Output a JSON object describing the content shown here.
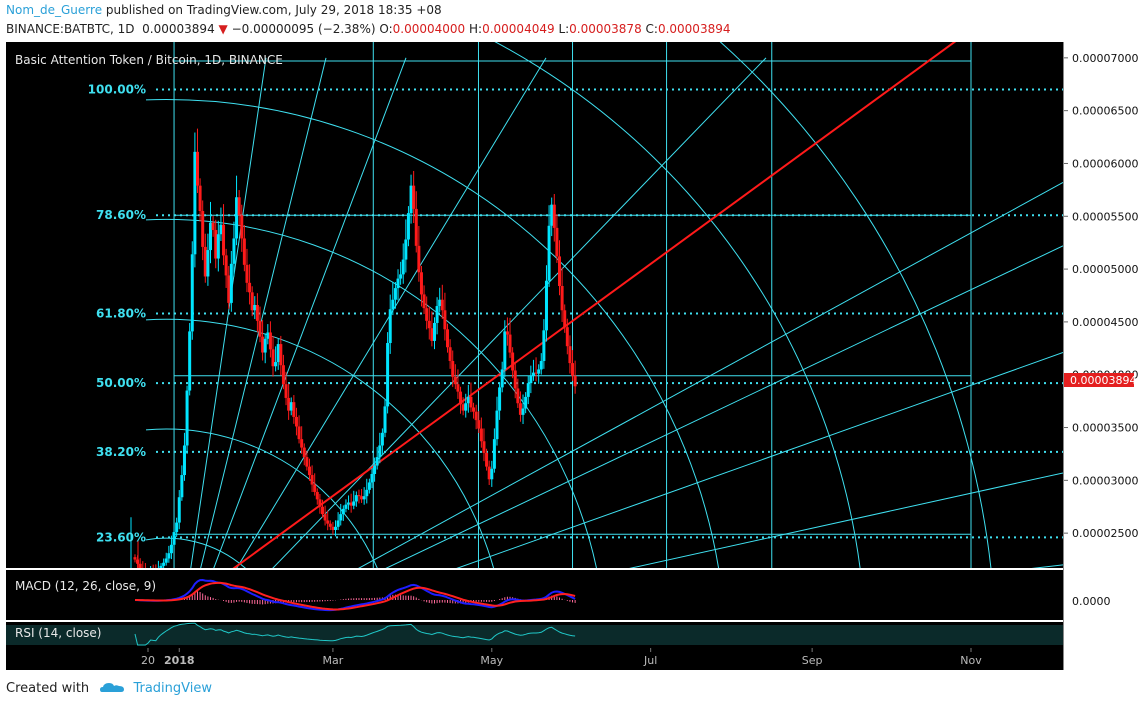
{
  "header": {
    "author": "Nom_de_Guerre",
    "published": "published on TradingView.com, July 29, 2018 18:35 +08",
    "symbol": "BINANCE:BATBTC, 1D",
    "last": "0.00003894",
    "change_arrow": "▼",
    "change": "−0.00000095 (−2.38%)",
    "o_label": "O:",
    "o_value": "0.00004000",
    "h_label": "H:",
    "h_value": "0.00004049",
    "l_label": "L:",
    "l_value": "0.00003878",
    "c_label": "C:",
    "c_value": "0.00003894"
  },
  "footer": {
    "created_with": "Created with",
    "brand": "TradingView",
    "logo_icon": "tradingview-cloud-icon"
  },
  "colors": {
    "bg": "#000000",
    "up": "#00e5ff",
    "down": "#ff1a1a",
    "fib": "#3fe0f0",
    "macd": "#1e1eff",
    "signal": "#ff2020",
    "rsi": "#20c8c8",
    "price_badge": "#e41f1f"
  },
  "chart_data": {
    "type": "candlestick",
    "title": "Basic Attention Token / Bitcoin, 1D, BINANCE",
    "y_ticks": [
      "0.00007000",
      "0.00006500",
      "0.00006000",
      "0.00005500",
      "0.00005000",
      "0.00004500",
      "0.00004000",
      "0.00003500",
      "0.00003000",
      "0.00002500"
    ],
    "ylim": [
      2.17e-05,
      7.15e-05
    ],
    "x_ticks": [
      "20",
      "2018",
      "Mar",
      "May",
      "Jul",
      "Sep",
      "Nov"
    ],
    "x_tick_dates": [
      "2017-12-20",
      "2018-01-01",
      "2018-03-01",
      "2018-05-01",
      "2018-07-01",
      "2018-09-01",
      "2018-11-01"
    ],
    "last_price": "0.00003894",
    "fib_levels": [
      {
        "label": "100.00%",
        "value": 6.7e-05
      },
      {
        "label": "78.60%",
        "value": 5.51e-05
      },
      {
        "label": "61.80%",
        "value": 4.58e-05
      },
      {
        "label": "50.00%",
        "value": 3.92e-05
      },
      {
        "label": "38.20%",
        "value": 3.27e-05
      },
      {
        "label": "23.60%",
        "value": 2.46e-05
      }
    ],
    "gann_lines": [
      6.97e-05,
      5.51e-05,
      3.99e-05,
      2.49e-05
    ],
    "close_series": {
      "start": "2017-12-15",
      "values": [
        2.25e-05,
        2.21e-05,
        2.17e-05,
        2.14e-05,
        2.12e-05,
        2.13e-05,
        2.15e-05,
        2.14e-05,
        2.13e-05,
        2.16e-05,
        2.19e-05,
        2.22e-05,
        2.26e-05,
        2.31e-05,
        2.39e-05,
        2.51e-05,
        2.6e-05,
        2.84e-05,
        3.05e-05,
        3.33e-05,
        3.85e-05,
        4.41e-05,
        5.14e-05,
        6.11e-05,
        5.79e-05,
        5.55e-05,
        5.21e-05,
        4.93e-05,
        5.18e-05,
        5.44e-05,
        5.37e-05,
        5.1e-05,
        5.33e-05,
        5.42e-05,
        5.13e-05,
        4.94e-05,
        4.68e-05,
        5.05e-05,
        5.29e-05,
        5.68e-05,
        5.51e-05,
        5.29e-05,
        5.04e-05,
        4.87e-05,
        4.78e-05,
        4.61e-05,
        4.66e-05,
        4.51e-05,
        4.36e-05,
        4.21e-05,
        4.34e-05,
        4.4e-05,
        4.24e-05,
        4.08e-05,
        4.12e-05,
        4.29e-05,
        4.09e-05,
        3.91e-05,
        3.78e-05,
        3.66e-05,
        3.74e-05,
        3.6e-05,
        3.51e-05,
        3.39e-05,
        3.31e-05,
        3.22e-05,
        3.13e-05,
        3.05e-05,
        2.96e-05,
        2.89e-05,
        2.82e-05,
        2.75e-05,
        2.68e-05,
        2.62e-05,
        2.59e-05,
        2.56e-05,
        2.53e-05,
        2.56e-05,
        2.62e-05,
        2.68e-05,
        2.73e-05,
        2.77e-05,
        2.79e-05,
        2.76e-05,
        2.8e-05,
        2.86e-05,
        2.85e-05,
        2.82e-05,
        2.85e-05,
        2.91e-05,
        2.98e-05,
        3.06e-05,
        3.14e-05,
        3.22e-05,
        3.33e-05,
        3.45e-05,
        3.7e-05,
        4.3e-05,
        4.62e-05,
        4.71e-05,
        4.82e-05,
        4.91e-05,
        4.95e-05,
        5.09e-05,
        5.28e-05,
        5.53e-05,
        5.79e-05,
        5.57e-05,
        5.22e-05,
        4.97e-05,
        4.76e-05,
        4.63e-05,
        4.51e-05,
        4.44e-05,
        4.32e-05,
        4.49e-05,
        4.65e-05,
        4.71e-05,
        4.61e-05,
        4.43e-05,
        4.26e-05,
        4.13e-05,
        3.98e-05,
        3.91e-05,
        3.84e-05,
        3.72e-05,
        3.66e-05,
        3.73e-05,
        3.79e-05,
        3.69e-05,
        3.65e-05,
        3.57e-05,
        3.49e-05,
        3.37e-05,
        3.26e-05,
        3.13e-05,
        3.01e-05,
        3.11e-05,
        3.39e-05,
        3.66e-05,
        3.88e-05,
        4.05e-05,
        4.41e-05,
        4.38e-05,
        4.21e-05,
        4.04e-05,
        3.87e-05,
        3.73e-05,
        3.62e-05,
        3.68e-05,
        3.79e-05,
        3.92e-05,
        3.99e-05,
        4.02e-05,
        4.01e-05,
        4.05e-05,
        4.13e-05,
        4.42e-05,
        4.89e-05,
        5.41e-05,
        5.61e-05,
        5.39e-05,
        5.12e-05,
        4.84e-05,
        4.61e-05,
        4.45e-05,
        4.27e-05,
        4.11e-05,
        3.99e-05,
        3.89e-05
      ]
    },
    "macd": {
      "title": "MACD (12, 26, close, 9)",
      "value_label": "0.0000"
    },
    "rsi": {
      "title": "RSI (14, close)"
    }
  }
}
